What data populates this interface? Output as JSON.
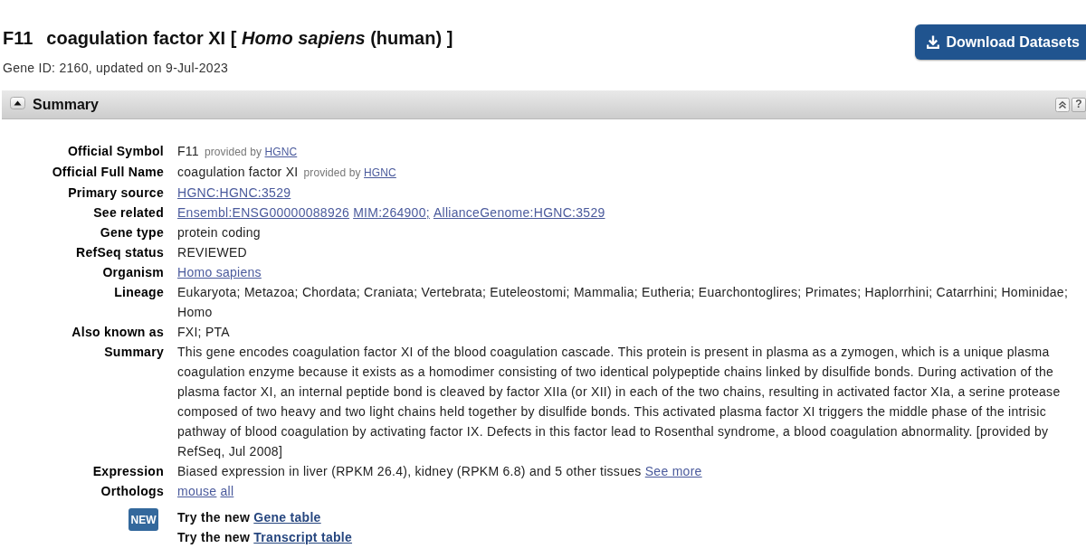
{
  "header": {
    "symbol": "F11",
    "title": "coagulation factor XI [ *Homo sapiens* (human) ]",
    "gene_id": "Gene ID: 2160, updated on 9-Jul-2023"
  },
  "download_button": {
    "label": "Download Datasets"
  },
  "section": {
    "title": "Summary",
    "expanded": true,
    "help_label": "?",
    "rows": [
      {
        "label": "Official Symbol",
        "parts": [
          {
            "kind": "text",
            "text": "F11"
          },
          {
            "kind": "provided",
            "text": "provided by",
            "link": "HGNC"
          }
        ]
      },
      {
        "label": "Official Full Name",
        "parts": [
          {
            "kind": "text",
            "text": "coagulation factor XI"
          },
          {
            "kind": "provided",
            "text": "provided by",
            "link": "HGNC"
          }
        ]
      },
      {
        "label": "Primary source",
        "parts": [
          {
            "kind": "link",
            "text": "HGNC:HGNC:3529"
          }
        ]
      },
      {
        "label": "See related",
        "parts": [
          {
            "kind": "link",
            "text": "Ensembl:ENSG00000088926"
          },
          {
            "kind": "link",
            "text": "MIM:264900;"
          },
          {
            "kind": "link",
            "text": "AllianceGenome:HGNC:3529"
          }
        ]
      },
      {
        "label": "Gene type",
        "parts": [
          {
            "kind": "text",
            "text": "protein coding"
          }
        ]
      },
      {
        "label": "RefSeq status",
        "parts": [
          {
            "kind": "text",
            "text": "REVIEWED"
          }
        ]
      },
      {
        "label": "Organism",
        "parts": [
          {
            "kind": "link",
            "text": "Homo sapiens"
          }
        ]
      },
      {
        "label": "Lineage",
        "parts": [
          {
            "kind": "text",
            "text": "Eukaryota; Metazoa; Chordata; Craniata; Vertebrata; Euteleostomi; Mammalia; Eutheria; Euarchontoglires; Primates; Haplorrhini; Catarrhini; Hominidae; Homo"
          }
        ]
      },
      {
        "label": "Also known as",
        "parts": [
          {
            "kind": "text",
            "text": "FXI; PTA"
          }
        ]
      },
      {
        "label": "Summary",
        "parts": [
          {
            "kind": "text",
            "text": "This gene encodes coagulation factor XI of the blood coagulation cascade. This protein is present in plasma as a zymogen, which is a unique plasma coagulation enzyme because it exists as a homodimer consisting of two identical polypeptide chains linked by disulfide bonds. During activation of the plasma factor XI, an internal peptide bond is cleaved by factor XIIa (or XII) in each of the two chains, resulting in activated factor XIa, a serine protease composed of two heavy and two light chains held together by disulfide bonds. This activated plasma factor XI triggers the middle phase of the intrisic pathway of blood coagulation by activating factor IX. Defects in this factor lead to Rosenthal syndrome, a blood coagulation abnormality. [provided by RefSeq, Jul 2008]"
          }
        ]
      },
      {
        "label": "Expression",
        "parts": [
          {
            "kind": "text",
            "text": "Biased expression in liver (RPKM 26.4), kidney (RPKM 6.8) and 5 other tissues",
            "link": "See more"
          }
        ]
      },
      {
        "label": "Orthologs",
        "parts": [
          {
            "kind": "link",
            "text": "mouse"
          },
          {
            "kind": "link",
            "text": "all"
          }
        ]
      }
    ],
    "new_links": {
      "badge": "NEW",
      "lines": [
        {
          "text": "Try the new",
          "link": "Gene table"
        },
        {
          "text": "Try the new",
          "link": "Transcript table"
        }
      ]
    }
  }
}
